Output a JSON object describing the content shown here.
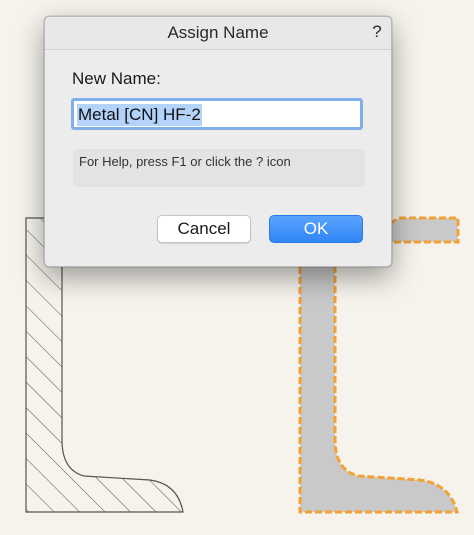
{
  "dialog": {
    "title": "Assign Name",
    "help_button_label": "?",
    "field_label": "New Name:",
    "name_value": "Metal [CN] HF-2",
    "help_text": "For Help, press F1 or click the ? icon",
    "cancel_label": "Cancel",
    "ok_label": "OK"
  },
  "colors": {
    "background": "#f6f3ec",
    "shape_fill": "#c9c9c9",
    "shape_stroke": "#555555",
    "selection_highlight": "#f5a033",
    "hatch": "#555555",
    "ok_button": "#3b8ff8"
  }
}
